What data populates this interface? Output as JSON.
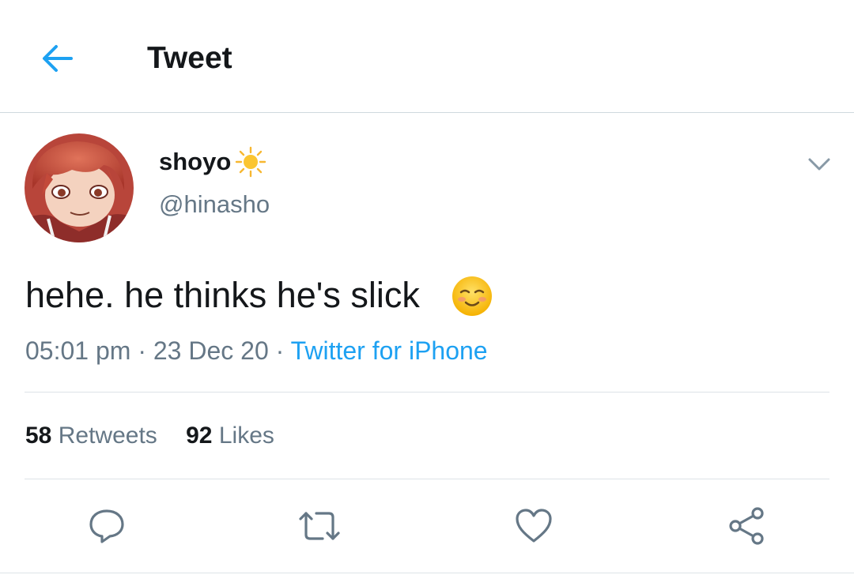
{
  "header": {
    "back_icon": "arrow-left-icon",
    "title": "Tweet"
  },
  "author": {
    "display_name": "shoyo",
    "name_emoji": "sun-icon",
    "handle": "@hinasho",
    "avatar": "anime-character-avatar"
  },
  "tweet": {
    "text": "hehe. he thinks he's slick",
    "emoji": "smiling-face-icon",
    "time": "05:01 pm",
    "date": "23 Dec 20",
    "separator": "·",
    "source": "Twitter for iPhone"
  },
  "stats": {
    "retweets_count": "58",
    "retweets_label": "Retweets",
    "likes_count": "92",
    "likes_label": "Likes"
  },
  "actions": [
    "reply-icon",
    "retweet-icon",
    "like-icon",
    "share-icon"
  ],
  "colors": {
    "accent": "#1da1f2",
    "text_primary": "#14171a",
    "text_secondary": "#657786",
    "divider": "#dde3e7"
  }
}
